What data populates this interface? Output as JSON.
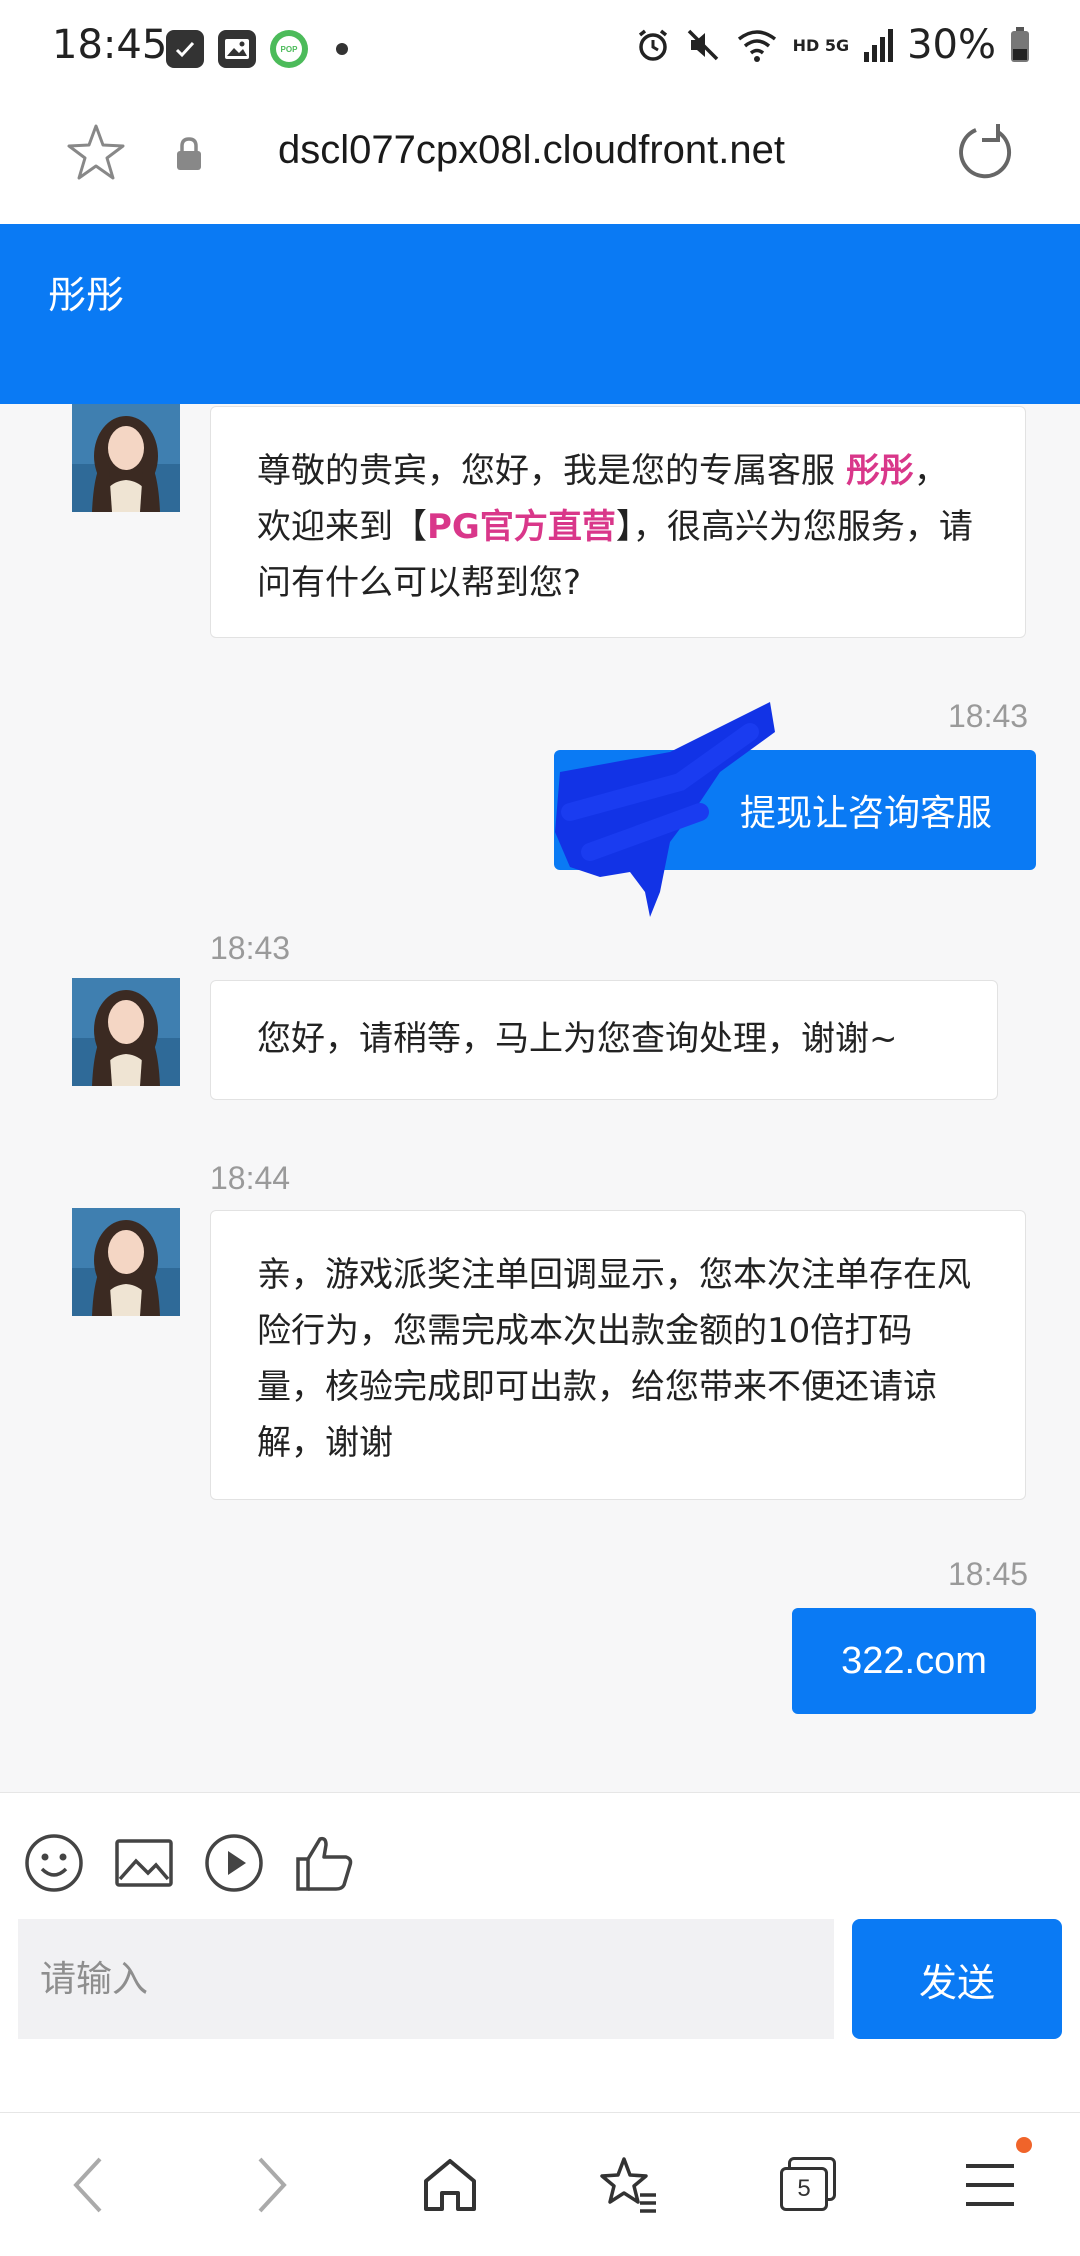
{
  "status_bar": {
    "time": "18:45",
    "network": "HD 5G",
    "battery": "30%"
  },
  "browser": {
    "url": "dscl077cpx08l.cloudfront.net",
    "tab_count": "5"
  },
  "chat": {
    "agent_name": "彤彤",
    "messages": [
      {
        "sender": "agent",
        "time": "",
        "text_before": "尊敬的贵宾，您好，我是您的专属客服 ",
        "highlight_1": "彤彤",
        "text_middle": "，欢迎来到【",
        "highlight_2": "PG官方直营",
        "text_after": "】，很高兴为您服务，请问有什么可以帮到您?"
      },
      {
        "sender": "user",
        "time": "18:43",
        "text": "提现让咨询客服"
      },
      {
        "sender": "agent",
        "time": "18:43",
        "text": "您好，请稍等，马上为您查询处理，谢谢~"
      },
      {
        "sender": "agent",
        "time": "18:44",
        "text": "亲，游戏派奖注单回调显示，您本次注单存在风险行为，您需完成本次出款金额的10倍打码量，核验完成即可出款，给您带来不便还请谅解，谢谢"
      },
      {
        "sender": "user",
        "time": "18:45",
        "text": "322.com"
      }
    ]
  },
  "input": {
    "placeholder": "请输入",
    "send_label": "发送"
  },
  "colors": {
    "primary": "#0a7af4",
    "highlight": "#d9378a"
  }
}
